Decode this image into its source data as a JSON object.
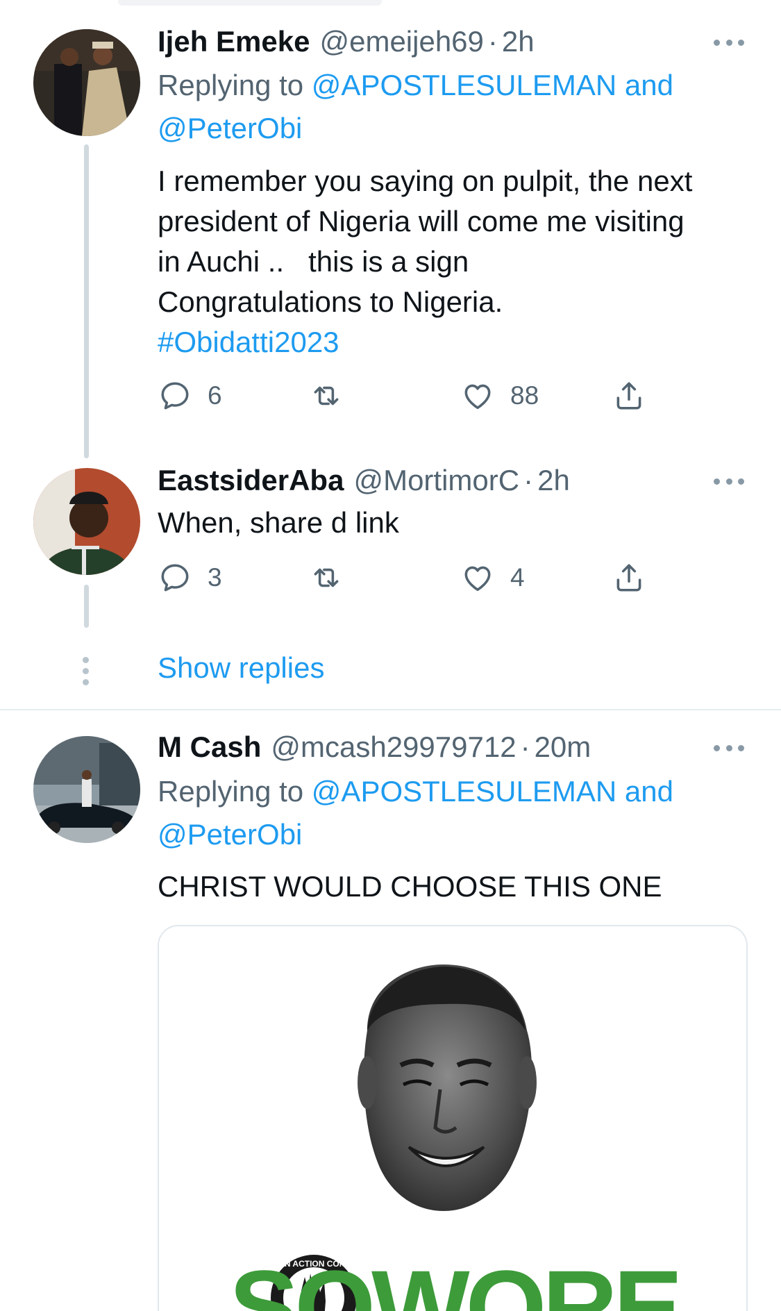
{
  "tweets": [
    {
      "name": "Ijeh Emeke",
      "handle": "@emeijeh69",
      "time": "2h",
      "replying_prefix": "Replying to",
      "mention1": "@APOSTLESULEMAN",
      "and": "and",
      "mention2": "@PeterObi",
      "text_lines": [
        "I remember you saying on pulpit, the next",
        "president of Nigeria will come me visiting",
        "in Auchi ..   this is a sign",
        "Congratulations to Nigeria."
      ],
      "hashtag": "#Obidatti2023",
      "replies": "6",
      "retweets": "",
      "likes": "88"
    },
    {
      "name": "EastsiderAba",
      "handle": "@MortimorC",
      "time": "2h",
      "text": "When, share d link",
      "replies": "3",
      "retweets": "",
      "likes": "4"
    },
    {
      "name": "M Cash",
      "handle": "@mcash29979712",
      "time": "20m",
      "replying_prefix": "Replying to",
      "mention1": "@APOSTLESULEMAN",
      "and": "and",
      "mention2": "@PeterObi",
      "text": "CHRIST WOULD CHOOSE THIS ONE"
    }
  ],
  "show_replies": "Show replies",
  "media": {
    "poster_word": "SOWORE",
    "logo_text": "AFRICAN ACTION CONGRESS"
  },
  "colors": {
    "link": "#1d9bf0",
    "secondary": "#536471",
    "poster_green": "#3d9b3a"
  },
  "icons": [
    "reply-icon",
    "retweet-icon",
    "like-icon",
    "share-icon",
    "more-icon"
  ]
}
